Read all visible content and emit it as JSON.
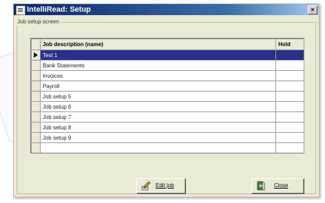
{
  "window": {
    "title": "IntelliRead: Setup",
    "close_glyph": "×"
  },
  "group": {
    "label": "Job setup screen"
  },
  "table": {
    "columns": [
      "Job description (name)",
      "Hold"
    ],
    "rows": [
      {
        "name": "Test 1",
        "hold": ""
      },
      {
        "name": "Bank Statements",
        "hold": ""
      },
      {
        "name": "Invoices",
        "hold": ""
      },
      {
        "name": "Payroll",
        "hold": ""
      },
      {
        "name": "Job setup 5",
        "hold": ""
      },
      {
        "name": "Job setup 6",
        "hold": ""
      },
      {
        "name": "Job setup 7",
        "hold": ""
      },
      {
        "name": "Job setup 8",
        "hold": ""
      },
      {
        "name": "Job setup 9",
        "hold": ""
      },
      {
        "name": "",
        "hold": ""
      }
    ]
  },
  "buttons": {
    "edit_job": {
      "label": "Edit job",
      "icon": "edit-pencil-icon"
    },
    "close": {
      "label": "Close",
      "icon": "exit-door-icon"
    }
  },
  "colors": {
    "selection": "#2a2f8a",
    "title_bar_start": "#0a246a",
    "title_bar_end": "#a6caf0",
    "window_face": "#ece9d8"
  }
}
